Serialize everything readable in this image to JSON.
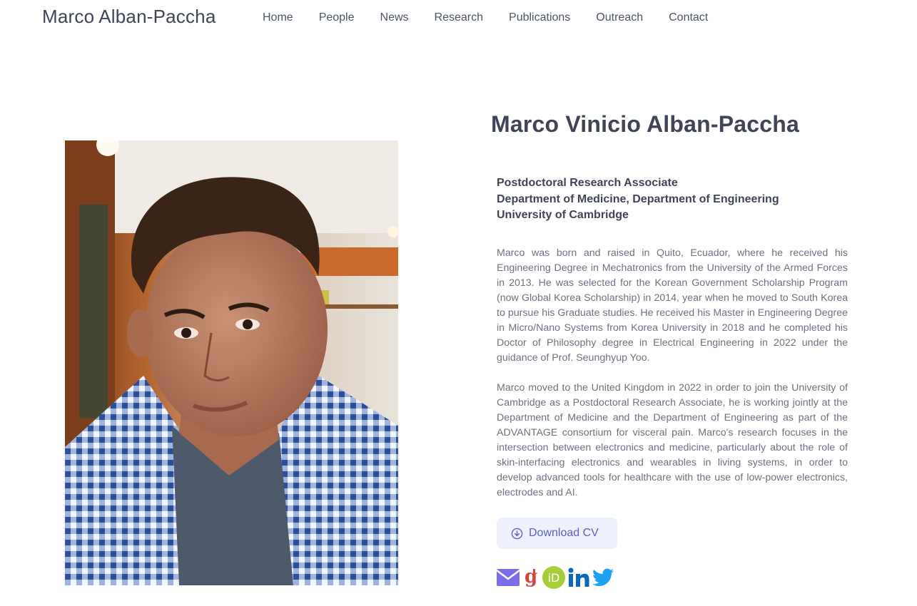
{
  "site": {
    "brand": "Marco Alban-Paccha"
  },
  "nav": {
    "items": [
      {
        "label": "Home"
      },
      {
        "label": "People"
      },
      {
        "label": "News"
      },
      {
        "label": "Research"
      },
      {
        "label": "Publications"
      },
      {
        "label": "Outreach"
      },
      {
        "label": "Contact"
      }
    ]
  },
  "profile": {
    "name": "Marco Vinicio Alban-Paccha",
    "affiliation": [
      "Postdoctoral Research Associate",
      "Department of Medicine, Department of Engineering",
      "University of Cambridge"
    ],
    "bio": [
      "Marco was born and raised in Quito, Ecuador, where he received his Engineering Degree in Mechatronics from the University of the Armed Forces in 2013. He was selected for the Korean Government Scholarship Program (now Global Korea Scholarship) in 2014, year when he moved to South Korea to pursue his Graduate studies. He received his Master in Engineering Degree in Micro/Nano Systems from Korea University in 2018 and he completed his Doctor of Philosophy degree in Electrical Engineering in 2022 under the guidance of Prof. Seunghyup Yoo.",
      "Marco moved to the United Kingdom in 2022 in order to join the University of Cambridge as a Postdoctoral Research Associate, he is working jointly at the Department of Medicine and the Department of Engineering as part of the ADVANTAGE consortium for visceral pain. Marco's research focuses in the intersection between electronics and medicine, particularly about the role of skin-interfacing electronics and wearables in living systems, in order to develop advanced tools for healthcare with the use of low-power electronics, electrodes and AI."
    ],
    "cv_button": "Download CV",
    "social_icons": [
      "envelope-icon",
      "google-scholar-icon",
      "orcid-icon",
      "linkedin-icon",
      "twitter-icon"
    ]
  },
  "colors": {
    "heading": "#3f4457",
    "body_text": "#6b7280",
    "accent": "#5b5fc7",
    "button_bg": "#eef0fb",
    "email": "#7c6ee6",
    "scholar": "#d6453d",
    "orcid": "#a6ce39",
    "linkedin": "#0a66c2",
    "twitter": "#1da1f2"
  }
}
